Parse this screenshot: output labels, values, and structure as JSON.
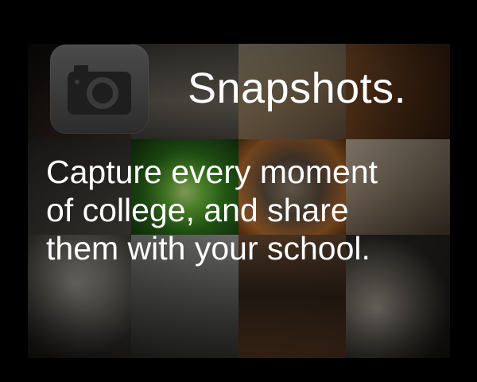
{
  "app": {
    "title": "Snapshots."
  },
  "tagline": {
    "line1": "Capture every moment",
    "line2": "of college, and share",
    "line3": "them with your school."
  },
  "icons": {
    "camera": "camera-icon"
  },
  "colors": {
    "background": "#000000",
    "text": "#ffffff",
    "icon_bg": "#3a3a3a"
  }
}
